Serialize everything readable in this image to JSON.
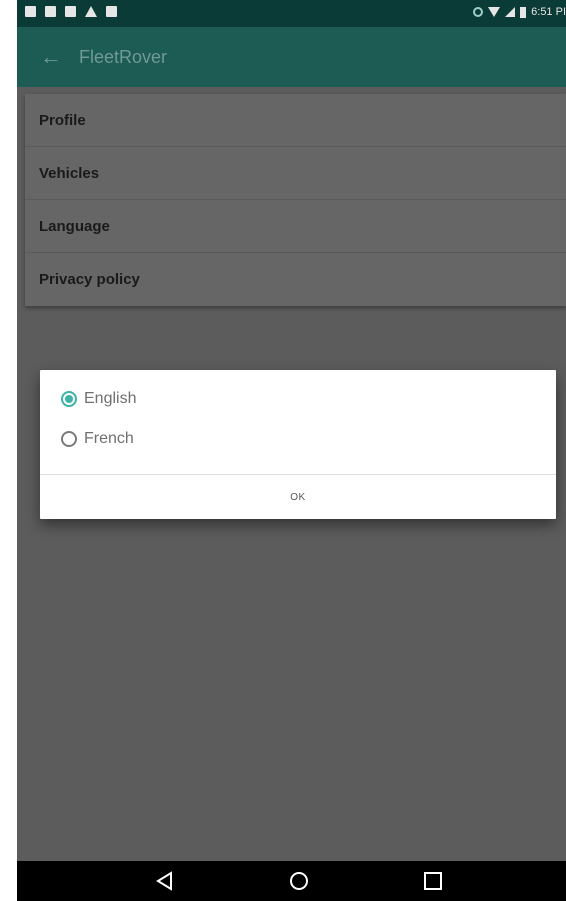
{
  "status_bar": {
    "time": "6:51 PI",
    "notification_icons": [
      "notification-icon",
      "usb-icon",
      "image-icon",
      "warning-icon",
      "download-icon"
    ],
    "system_icons": [
      "sync-icon",
      "wifi-icon",
      "signal-icon",
      "battery-icon"
    ]
  },
  "toolbar": {
    "title": "FleetRover",
    "back_icon": "arrow-left-icon"
  },
  "settings": {
    "items": [
      {
        "label": "Profile"
      },
      {
        "label": "Vehicles"
      },
      {
        "label": "Language"
      },
      {
        "label": "Privacy policy"
      }
    ]
  },
  "dialog": {
    "options": [
      {
        "label": "English",
        "selected": true
      },
      {
        "label": "French",
        "selected": false
      }
    ],
    "ok_label": "OK"
  },
  "nav_bar": {
    "buttons": [
      "back-triangle-icon",
      "home-circle-icon",
      "recents-square-icon"
    ]
  },
  "colors": {
    "status_bar": "#0b3b36",
    "toolbar": "#1d5b55",
    "accent": "#3bb3a6",
    "scrim": "#5c5c5c"
  }
}
